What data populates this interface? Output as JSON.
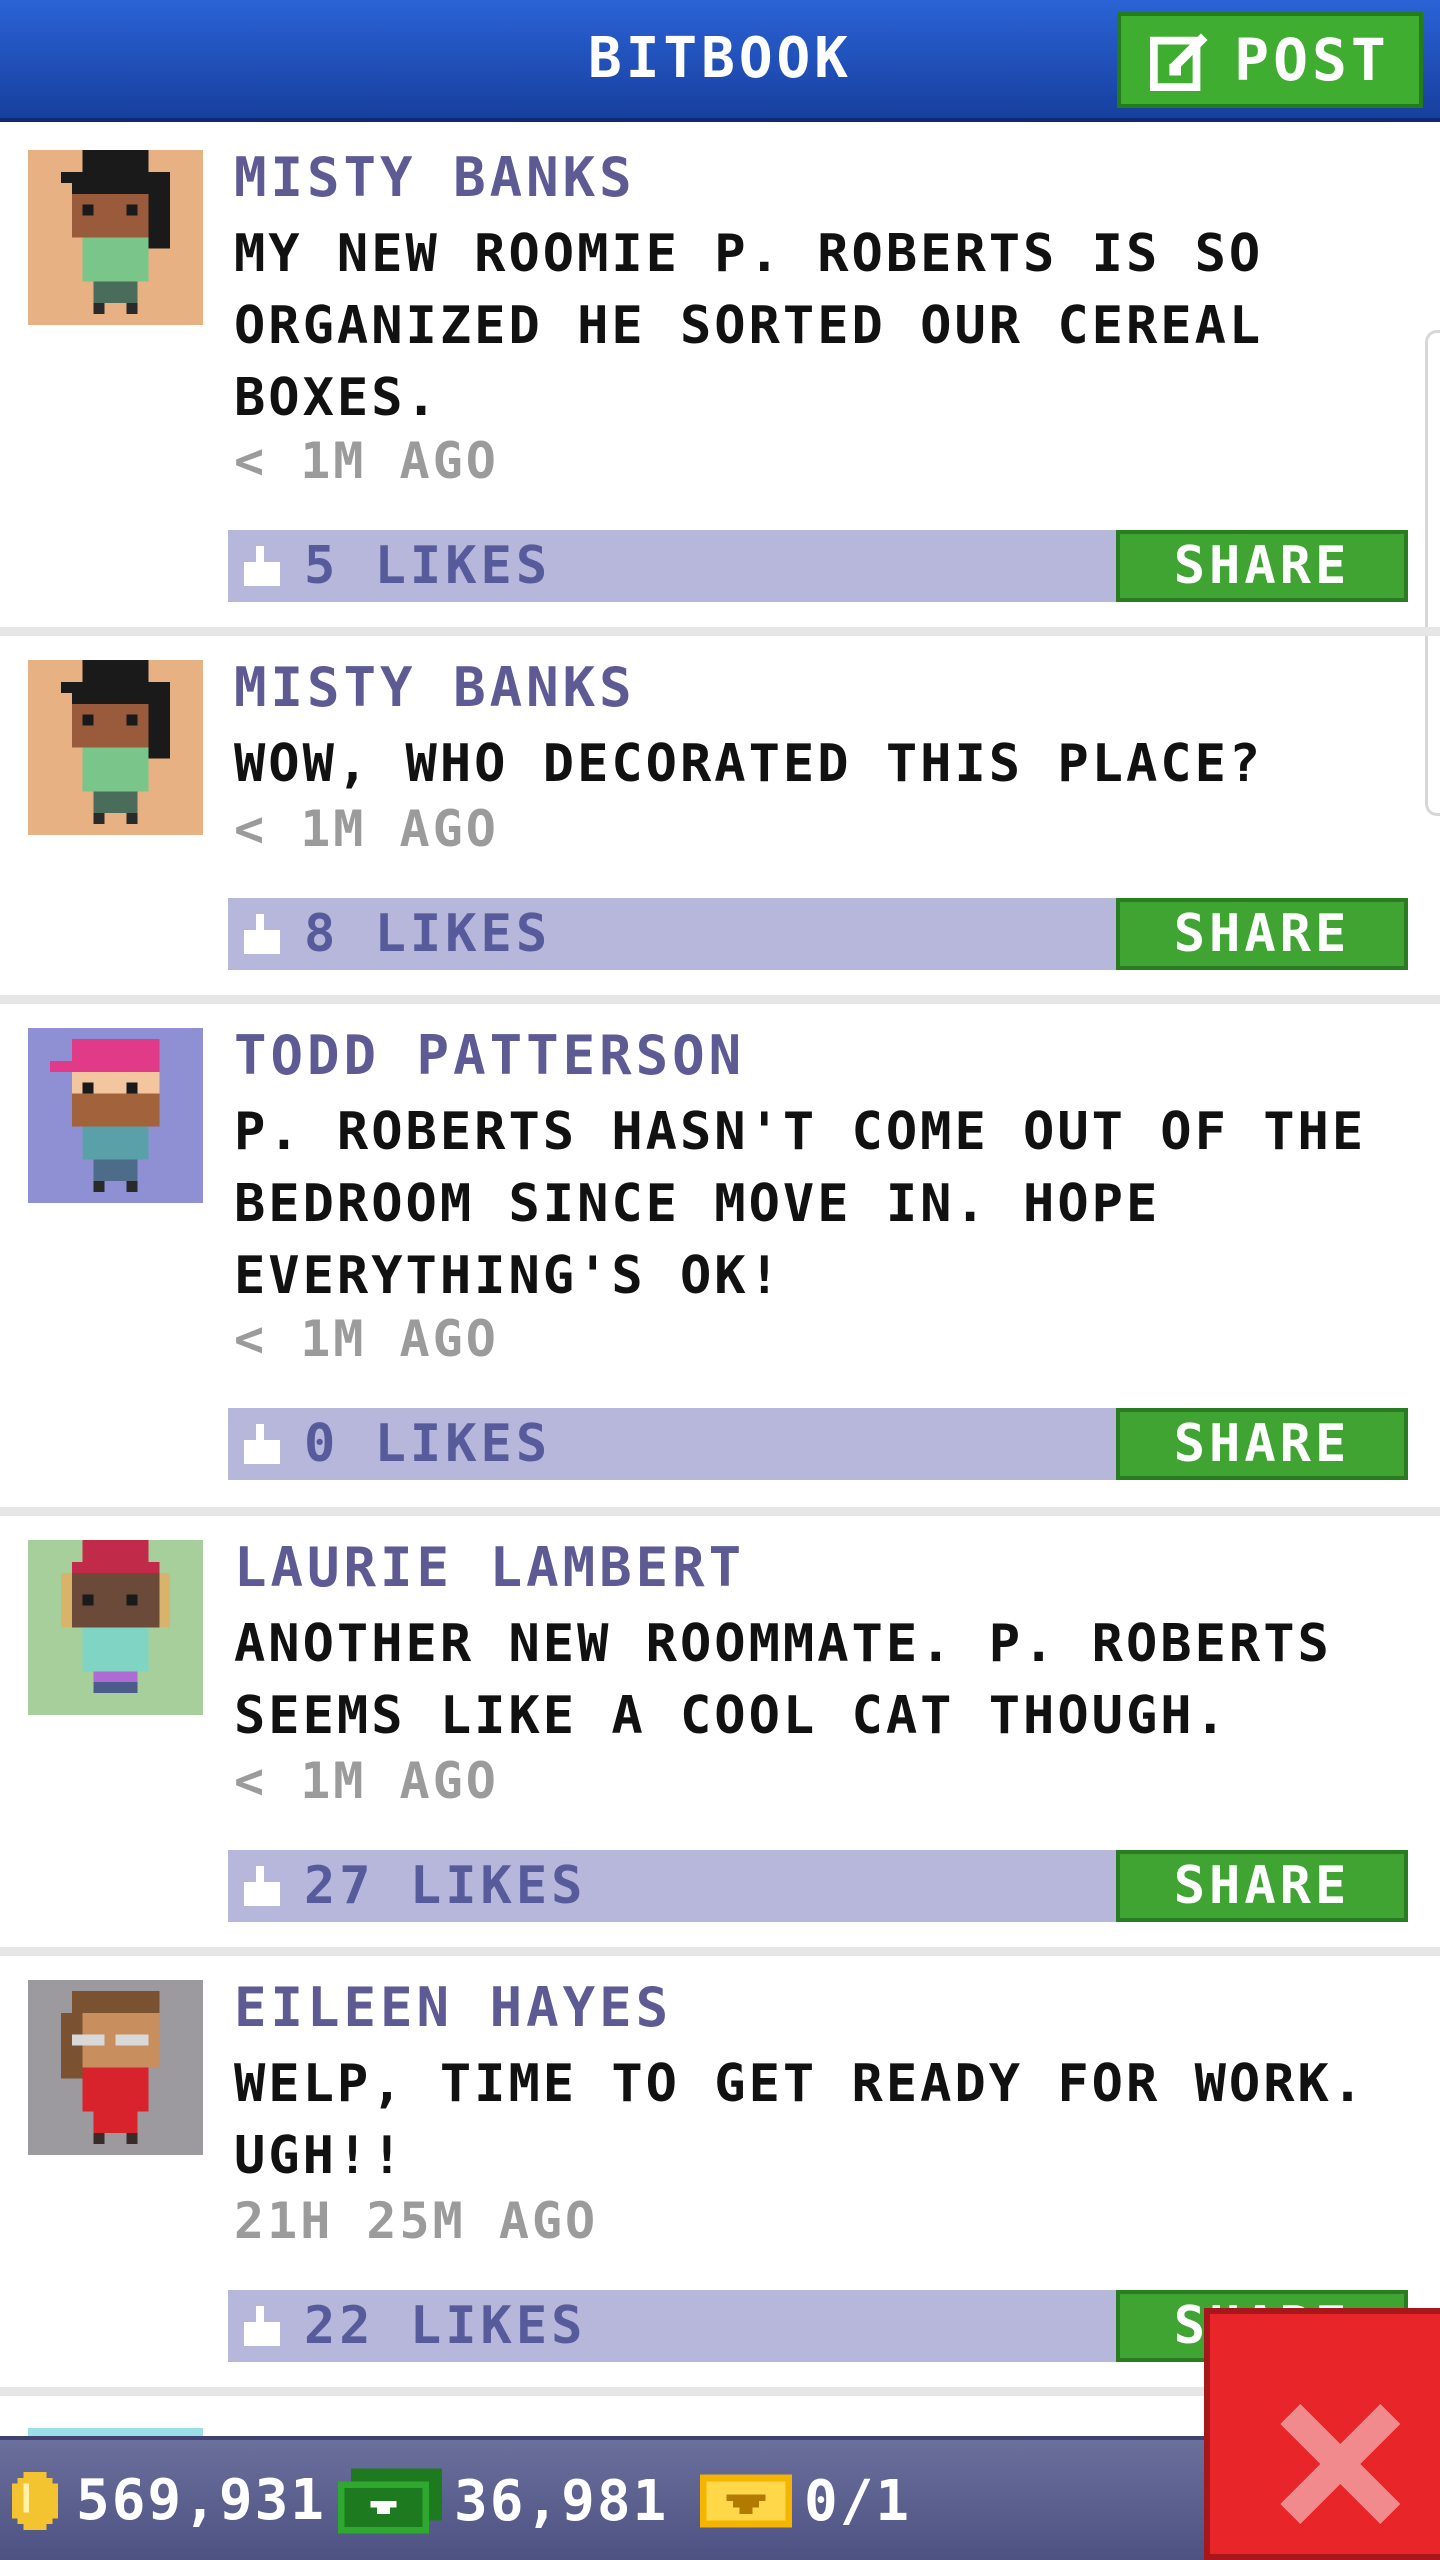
{
  "header": {
    "title": "BITBOOK",
    "post_label": "POST",
    "post_icon": "edit-icon"
  },
  "posts": [
    {
      "author": "MISTY BANKS",
      "text": "MY NEW ROOMIE P. ROBERTS IS SO ORGANIZED HE SORTED OUR CEREAL BOXES.",
      "time": "< 1M AGO",
      "likes": "5 LIKES",
      "share": "SHARE",
      "avatar_bg": "#e8b184",
      "avatar": "misty-banks-avatar"
    },
    {
      "author": "MISTY BANKS",
      "text": "WOW, WHO DECORATED THIS PLACE?",
      "time": "< 1M AGO",
      "likes": "8 LIKES",
      "share": "SHARE",
      "avatar_bg": "#e8b184",
      "avatar": "misty-banks-avatar"
    },
    {
      "author": "TODD PATTERSON",
      "text": "P. ROBERTS HASN'T COME OUT OF THE BEDROOM SINCE MOVE IN. HOPE EVERYTHING'S OK!",
      "time": "< 1M AGO",
      "likes": "0 LIKES",
      "share": "SHARE",
      "avatar_bg": "#8f8fd4",
      "avatar": "todd-patterson-avatar"
    },
    {
      "author": "LAURIE LAMBERT",
      "text": "ANOTHER NEW ROOMMATE. P. ROBERTS SEEMS LIKE A COOL CAT THOUGH.",
      "time": "< 1M AGO",
      "likes": "27 LIKES",
      "share": "SHARE",
      "avatar_bg": "#a7cf9b",
      "avatar": "laurie-lambert-avatar"
    },
    {
      "author": "EILEEN HAYES",
      "text": "WELP, TIME TO GET READY FOR WORK. UGH!!",
      "time": "21H 25M AGO",
      "likes": "22 LIKES",
      "share": "SHARE",
      "avatar_bg": "#9c9a9f",
      "avatar": "eileen-hayes-avatar"
    }
  ],
  "footer": {
    "coins": "569,931",
    "bux": "36,981",
    "tickets": "0/1"
  },
  "colors": {
    "header": "#2453c7",
    "post_button": "#3fad2f",
    "share_button": "#3fa432",
    "likebar": "#b6b7da",
    "author": "#5d5a94",
    "close_button": "#e8262a",
    "footer": "#5c5f8e"
  }
}
